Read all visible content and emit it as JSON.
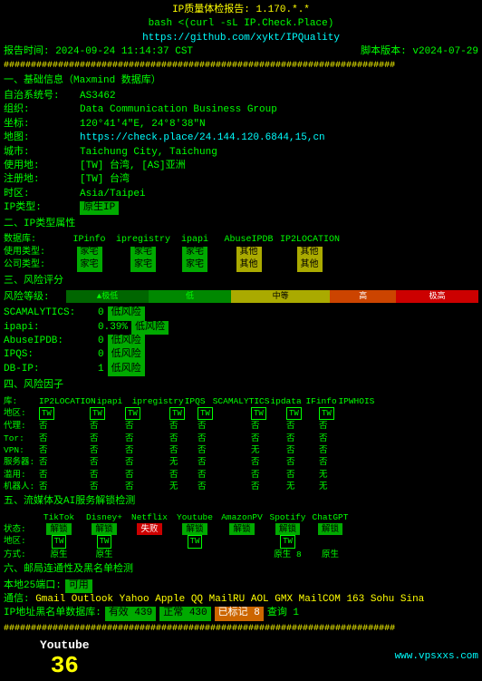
{
  "header": {
    "title": "IP质量体检报告: 1.170.*.*",
    "command": "bash <(curl -sL IP.Check.Place)",
    "github": "https://github.com/xykt/IPQuality",
    "report_time": "报告时间: 2024-09-24 11:14:37 CST",
    "script_version": "脚本版本: v2024-07-29"
  },
  "hash_line": "########################################################################",
  "sections": {
    "basic": {
      "title": "一、基础信息（Maxmind 数据库）",
      "asn": "AS3462",
      "org": "Data Communication Business Group",
      "coords": "120°41′4″E, 24°8′38″N",
      "map_url": "https://check.place/24.144.120.6844,15,cn",
      "city": "Taichung City, Taichung",
      "usage": "[TW] 台湾, [AS]亚洲",
      "register": "[TW] 台湾",
      "timezone": "Asia/Taipei",
      "ip_type": "原生IP",
      "labels": {
        "asn": "自治系统号:",
        "org": "组织:",
        "coords": "坐标:",
        "map": "地图:",
        "city": "城市:",
        "usage": "使用地:",
        "register": "注册地:",
        "timezone": "时区:",
        "ip_type": "IP类型:"
      }
    },
    "ip_type_props": {
      "title": "二、IP类型属性",
      "headers": [
        "数据库:",
        "IPinfo",
        "ipregistry",
        "ipapi",
        "AbuseIPDB",
        "IP2LOCATION"
      ],
      "usage_row": [
        "使用类型:",
        "家宅",
        "家宅",
        "家宅",
        "",
        ""
      ],
      "company_row": [
        "公司类型:",
        "家宅",
        "家宅",
        "家宅",
        "",
        ""
      ],
      "usage_badges": [
        "green",
        "green",
        "green",
        "yellow",
        "yellow"
      ],
      "company_badges": [
        "green",
        "green",
        "green",
        "yellow",
        "yellow"
      ],
      "usage_labels": [
        "家宅",
        "家宅",
        "家宅",
        "其他",
        "其他"
      ],
      "company_labels": [
        "家宅",
        "家宅",
        "家宅",
        "其他",
        "其他"
      ]
    },
    "risk": {
      "title": "三、风险评分",
      "level_label": "风险等级:",
      "levels": [
        "极低",
        "低",
        "中等",
        "高",
        "极高"
      ],
      "pointer_pos": 0,
      "scamalytics": "0|低风险",
      "scamalytics_label": "SCAMALYTICS:",
      "ipapi": "0.39%|低风险",
      "ipapi_label": "ipapi:",
      "abuseipdb": "0|低风险",
      "abuseipdb_label": "AbuseIPDB:",
      "ipqs": "0|低风险",
      "ipqs_label": "IPQS:",
      "dbip": "1|低风险",
      "dbip_label": "DB-IP:"
    },
    "risk_factors": {
      "title": "四、风险因子",
      "headers": [
        "库:",
        "IP2LOCATION",
        "ipapi",
        "ipregistry",
        "IPQS",
        "SCAMALYTICS",
        "ipdata",
        "IFinfo",
        "IPWHOIS"
      ],
      "region_row": [
        "地区:",
        "[TW]",
        "[TW]",
        "[TW]",
        "[TW]",
        "[TW]",
        "[TW]",
        "[TW]",
        "[TW]"
      ],
      "proxy_row": [
        "代理:",
        "否",
        "否",
        "否",
        "否",
        "否",
        "否",
        "否",
        "否"
      ],
      "tor_row": [
        "Tor:",
        "否",
        "否",
        "否",
        "否",
        "否",
        "否",
        "否",
        "否"
      ],
      "vpn_row": [
        "VPN:",
        "否",
        "否",
        "否",
        "否",
        "否",
        "无",
        "否",
        "否"
      ],
      "server_row": [
        "服务器:",
        "否",
        "否",
        "否",
        "无",
        "否",
        "否",
        "否",
        "否"
      ],
      "abuse_row": [
        "滥用:",
        "否",
        "否",
        "否",
        "否",
        "否",
        "否",
        "否",
        "无"
      ],
      "bot_row": [
        "机器人:",
        "否",
        "否",
        "否",
        "无",
        "否",
        "否",
        "无",
        "无"
      ]
    },
    "media": {
      "title": "五、流媒体及AI服务解锁检测",
      "headers": [
        "",
        "TikTok",
        "Disney+",
        "Netflix",
        "Youtube",
        "AmazonPV",
        "Spotify",
        "ChatGPT"
      ],
      "status_row": [
        "状态:",
        "解锁",
        "解锁",
        "失败",
        "解锁",
        "解锁",
        "解锁",
        "解锁"
      ],
      "status_types": [
        "green",
        "green",
        "red",
        "green",
        "green",
        "green",
        "green"
      ],
      "region_row": [
        "地区:",
        "[TW]",
        "[TW]",
        "",
        "[TW]",
        "",
        "[TW]",
        ""
      ],
      "method_row": [
        "方式:",
        "原生",
        "原生",
        "",
        "",
        "",
        "原生 8",
        "原生"
      ]
    },
    "mail": {
      "title": "六、邮局连通性及黑名单检测",
      "china25": "本地25端口: 可用",
      "isp_block": "通信: Gmail Outlook Yahoo Apple QQ MailRU AOL GMX MailCOM 163 Sohu Sina",
      "dns_label": "IP地址黑名单数据库:",
      "dns_valid": "有效 439",
      "dns_error": "正常 430",
      "dns_marked": "已标记 8",
      "dns_invalid": "查询 1"
    }
  },
  "footer": {
    "website": "www.vpsxxs.com",
    "youtube": {
      "label": "Youtube",
      "number": "36"
    }
  }
}
